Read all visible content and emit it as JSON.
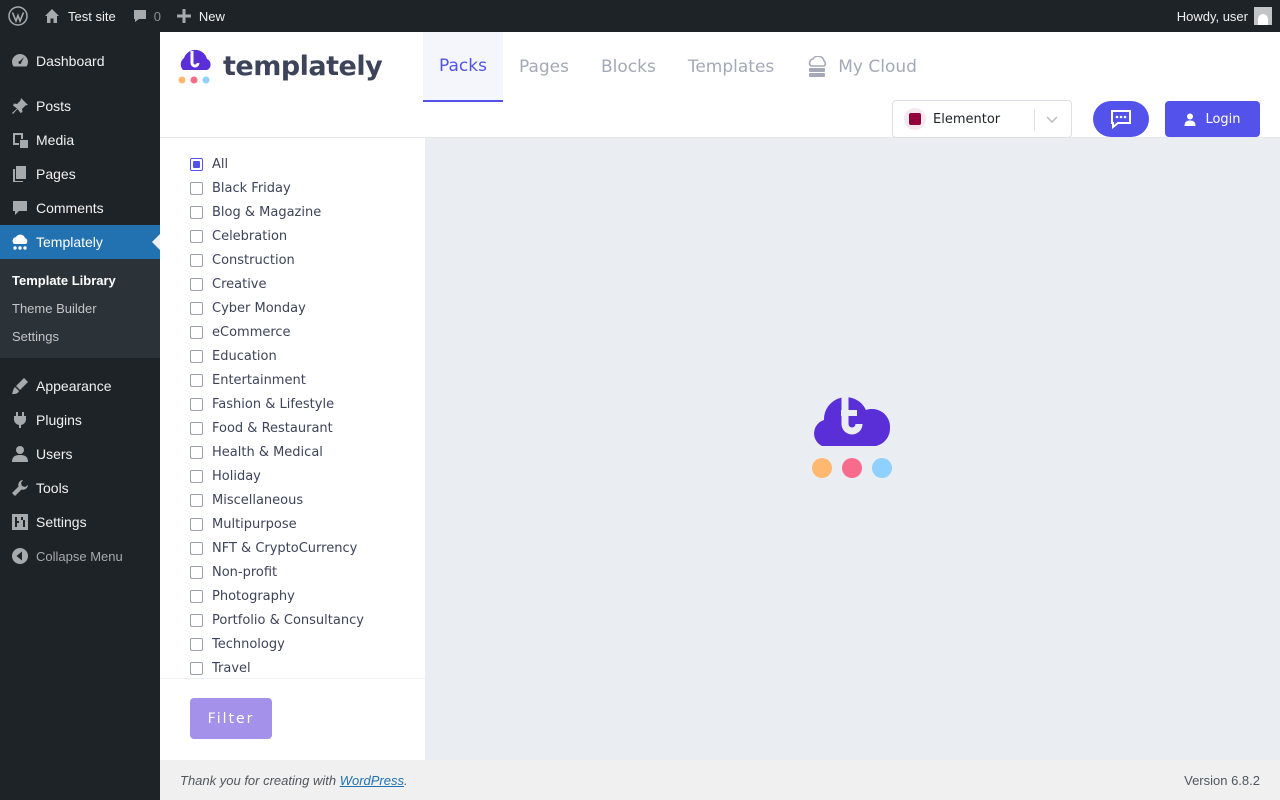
{
  "admin_bar": {
    "site_name": "Test site",
    "comments_count": "0",
    "new_label": "New",
    "greeting": "Howdy, user"
  },
  "sidebar": {
    "items": [
      {
        "label": "Dashboard",
        "icon": "dashboard-icon"
      },
      {
        "label": "Posts",
        "icon": "pin-icon"
      },
      {
        "label": "Media",
        "icon": "media-icon"
      },
      {
        "label": "Pages",
        "icon": "pages-icon"
      },
      {
        "label": "Comments",
        "icon": "comment-icon"
      },
      {
        "label": "Templately",
        "icon": "templately-icon"
      }
    ],
    "submenu": [
      "Template Library",
      "Theme Builder",
      "Settings"
    ],
    "items_after": [
      {
        "label": "Appearance",
        "icon": "brush-icon"
      },
      {
        "label": "Plugins",
        "icon": "plugin-icon"
      },
      {
        "label": "Users",
        "icon": "user-icon"
      },
      {
        "label": "Tools",
        "icon": "wrench-icon"
      },
      {
        "label": "Settings",
        "icon": "settings-icon"
      }
    ],
    "collapse_label": "Collapse Menu"
  },
  "header": {
    "logo_text": "templately",
    "tabs": [
      "Packs",
      "Pages",
      "Blocks",
      "Templates",
      "My Cloud"
    ],
    "active_tab": "Packs",
    "builder_select": "Elementor",
    "login_label": "Login"
  },
  "filter": {
    "categories": [
      "All",
      "Black Friday",
      "Blog & Magazine",
      "Celebration",
      "Construction",
      "Creative",
      "Cyber Monday",
      "eCommerce",
      "Education",
      "Entertainment",
      "Fashion & Lifestyle",
      "Food & Restaurant",
      "Health & Medical",
      "Holiday",
      "Miscellaneous",
      "Multipurpose",
      "NFT & CryptoCurrency",
      "Non-profit",
      "Photography",
      "Portfolio & Consultancy",
      "Technology",
      "Travel"
    ],
    "checked": [
      "All"
    ],
    "button_label": "Filter"
  },
  "footer": {
    "thanks_prefix": "Thank you for creating with ",
    "thanks_link": "WordPress",
    "thanks_suffix": ".",
    "version": "Version 6.8.2"
  },
  "colors": {
    "accent": "#5353ec",
    "wp_blue": "#2271b1",
    "admin_dark": "#1d2327",
    "loader_orange": "#ffb870",
    "loader_pink": "#f76c8a",
    "loader_blue": "#8fd0ff"
  }
}
